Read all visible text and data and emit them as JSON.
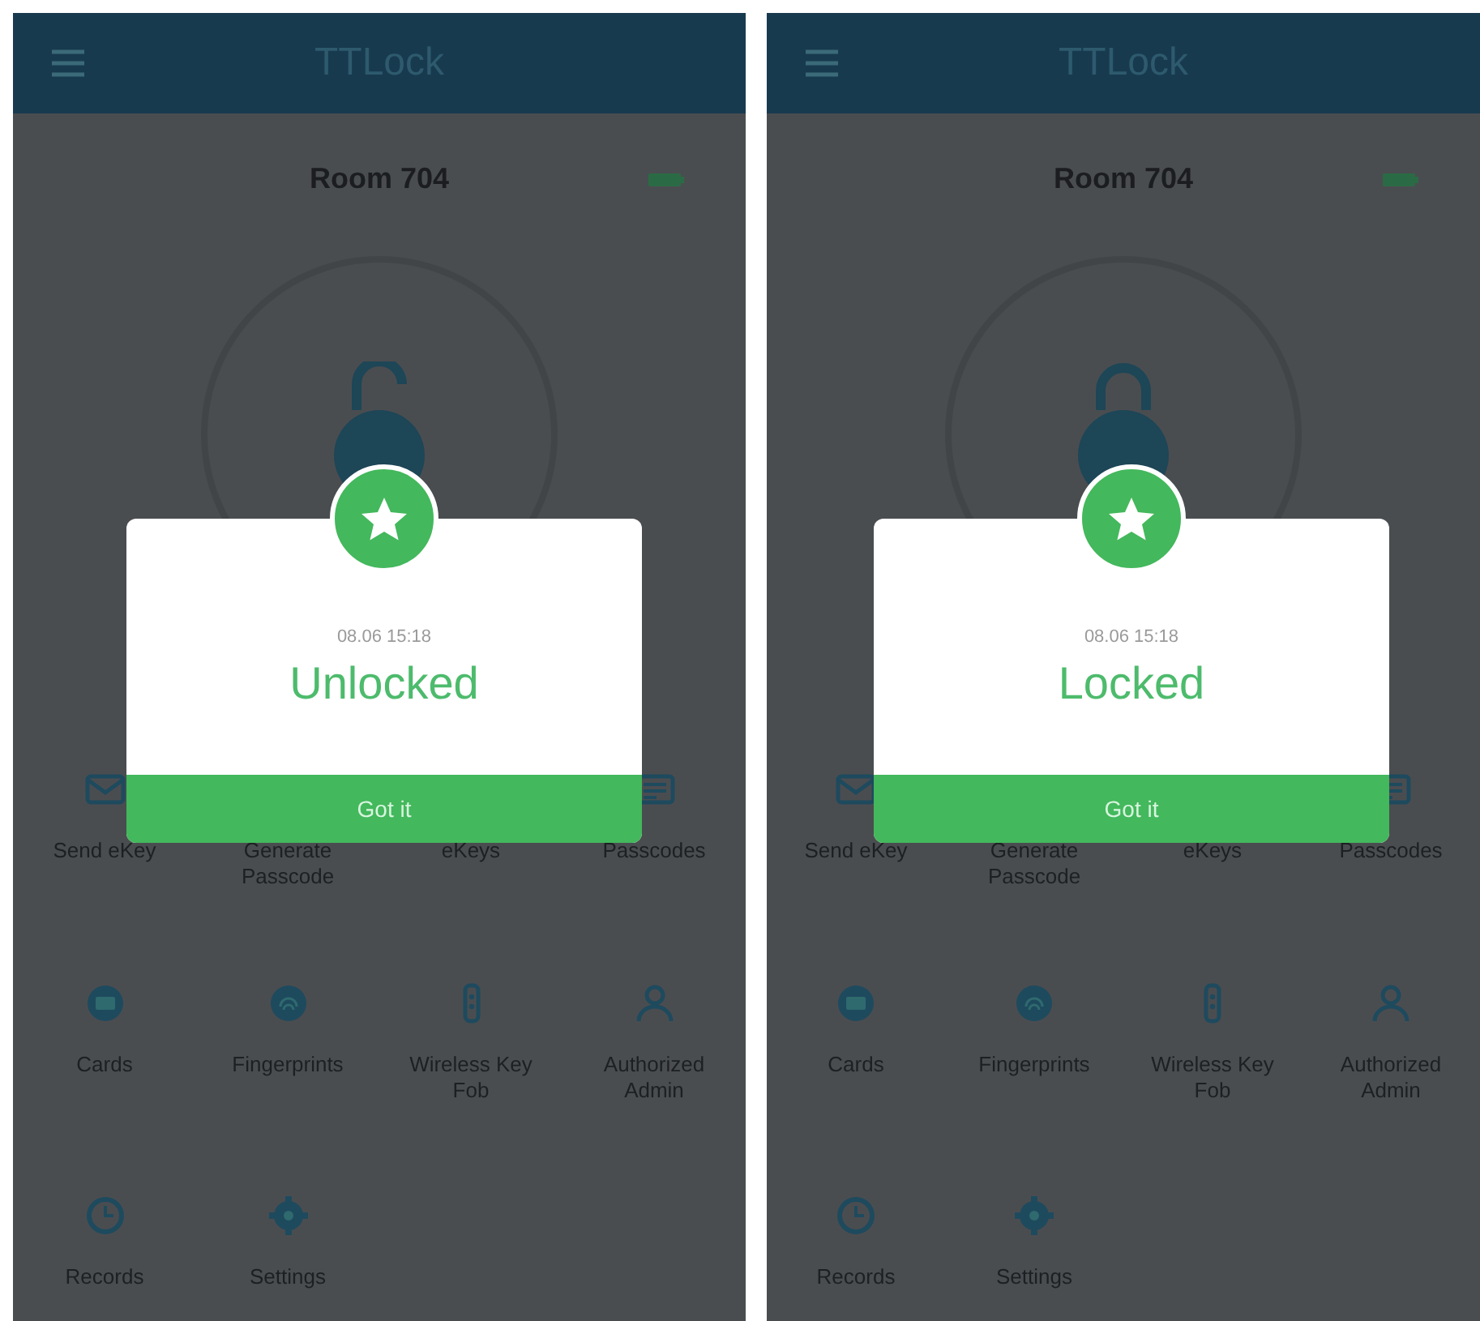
{
  "screens": [
    {
      "app_title": "TTLock",
      "room": "Room 704",
      "locked": false,
      "dialog": {
        "time": "08.06 15:18",
        "status": "Unlocked",
        "button": "Got it"
      },
      "menu": [
        {
          "label": "Send eKey",
          "kind": "send"
        },
        {
          "label": "Generate Passcode",
          "kind": "generate"
        },
        {
          "label": "eKeys",
          "kind": "ekeys"
        },
        {
          "label": "Passcodes",
          "kind": "passcodes"
        },
        {
          "label": "Cards",
          "kind": "cards"
        },
        {
          "label": "Fingerprints",
          "kind": "fingerprint"
        },
        {
          "label": "Wireless Key Fob",
          "kind": "fob"
        },
        {
          "label": "Authorized Admin",
          "kind": "admin"
        },
        {
          "label": "Records",
          "kind": "records"
        },
        {
          "label": "Settings",
          "kind": "settings"
        }
      ]
    },
    {
      "app_title": "TTLock",
      "room": "Room 704",
      "locked": true,
      "dialog": {
        "time": "08.06 15:18",
        "status": "Locked",
        "button": "Got it"
      },
      "menu": [
        {
          "label": "Send eKey",
          "kind": "send"
        },
        {
          "label": "Generate Passcode",
          "kind": "generate"
        },
        {
          "label": "eKeys",
          "kind": "ekeys"
        },
        {
          "label": "Passcodes",
          "kind": "passcodes"
        },
        {
          "label": "Cards",
          "kind": "cards"
        },
        {
          "label": "Fingerprints",
          "kind": "fingerprint"
        },
        {
          "label": "Wireless Key Fob",
          "kind": "fob"
        },
        {
          "label": "Authorized Admin",
          "kind": "admin"
        },
        {
          "label": "Records",
          "kind": "records"
        },
        {
          "label": "Settings",
          "kind": "settings"
        }
      ]
    }
  ]
}
